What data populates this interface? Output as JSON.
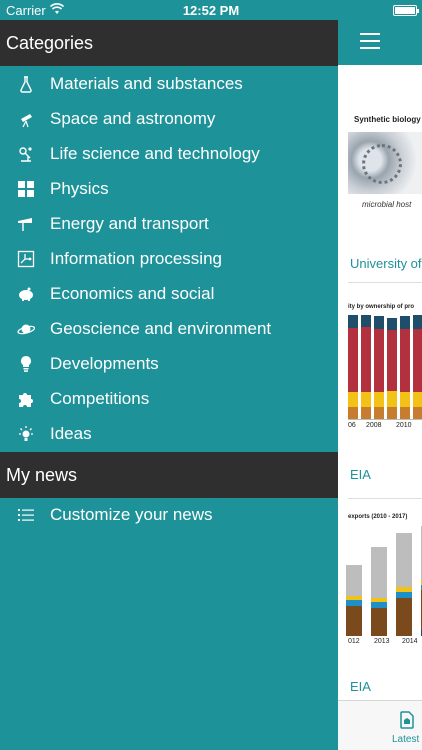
{
  "status": {
    "carrier": "Carrier",
    "time": "12:52 PM"
  },
  "drawer": {
    "categories_title": "Categories",
    "categories": [
      {
        "label": "Materials and substances",
        "icon": "flask-icon"
      },
      {
        "label": "Space and astronomy",
        "icon": "telescope-icon"
      },
      {
        "label": "Life science and technology",
        "icon": "microscope-icon"
      },
      {
        "label": "Physics",
        "icon": "calculator-icon"
      },
      {
        "label": "Energy and transport",
        "icon": "gas-pump-icon"
      },
      {
        "label": "Information processing",
        "icon": "circuit-icon"
      },
      {
        "label": "Economics and social",
        "icon": "piggy-bank-icon"
      },
      {
        "label": "Geoscience and environment",
        "icon": "planet-icon"
      },
      {
        "label": "Developments",
        "icon": "lightbulb-icon"
      },
      {
        "label": "Competitions",
        "icon": "puzzle-icon"
      },
      {
        "label": "Ideas",
        "icon": "bright-idea-icon"
      }
    ],
    "mynews_title": "My news",
    "customize_label": "Customize your news"
  },
  "peek": {
    "article1": {
      "image_caption": "Synthetic biology",
      "image_subcaption": "microbial host",
      "source": "University of"
    },
    "article2": {
      "chart_title": "ity by ownership of pro",
      "ticks": [
        "06",
        "2008",
        "2010"
      ],
      "source": "EIA"
    },
    "article3": {
      "chart_title": "exports (2010 - 2017)",
      "ticks": [
        "012",
        "2013",
        "2014"
      ],
      "source": "EIA"
    },
    "tab_label": "Latest"
  },
  "colors": {
    "accent": "#1e9299",
    "header": "#2f2f2f"
  },
  "chart_data": [
    {
      "type": "bar",
      "title": "ity by ownership of pro",
      "categories": [
        "06",
        "2008",
        "2010"
      ],
      "series": [
        {
          "name": "",
          "values": [
            12,
            12,
            12,
            12,
            12,
            12
          ]
        },
        {
          "name": "",
          "values": [
            15,
            15,
            15,
            16,
            15,
            15
          ]
        },
        {
          "name": "",
          "values": [
            63,
            64,
            62,
            60,
            62,
            62
          ]
        },
        {
          "name": "",
          "values": [
            13,
            12,
            13,
            12,
            13,
            14
          ]
        }
      ],
      "colors": [
        "#c87d2e",
        "#f2c316",
        "#b3313f",
        "#1f4e6b"
      ]
    },
    {
      "type": "bar",
      "title": "exports (2010 - 2017)",
      "categories": [
        "012",
        "2013",
        "2014"
      ],
      "series": [
        {
          "name": "",
          "values": [
            0,
            0,
            0,
            6
          ]
        },
        {
          "name": "",
          "values": [
            30,
            28,
            38,
            40
          ]
        },
        {
          "name": "",
          "values": [
            6,
            6,
            6,
            6
          ]
        },
        {
          "name": "",
          "values": [
            4,
            4,
            5,
            5
          ]
        },
        {
          "name": "",
          "values": [
            32,
            52,
            55,
            54
          ]
        }
      ],
      "colors": [
        "#1f4e6b",
        "#7a4a1c",
        "#1e90c8",
        "#f2c316",
        "#bdbdbd"
      ]
    }
  ]
}
